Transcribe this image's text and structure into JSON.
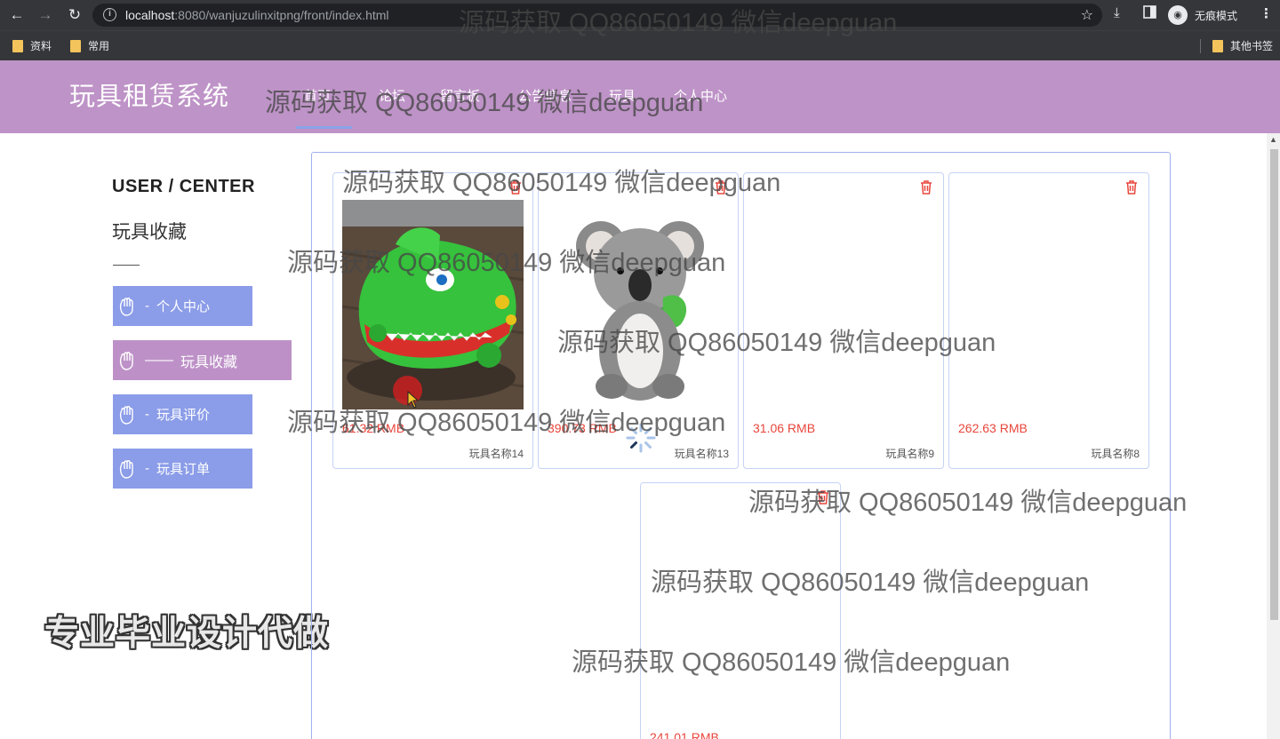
{
  "browser": {
    "url_host": "localhost",
    "url_path": ":8080/wanjuzulinxitpng/front/index.html",
    "incognito_label": "无痕模式",
    "bookmarks": [
      "资料",
      "常用"
    ],
    "other_bookmarks": "其他书签"
  },
  "header": {
    "site_title": "玩具租赁系统",
    "nav": [
      "首页",
      "论坛",
      "留言板",
      "公告信息",
      "玩具",
      "个人中心"
    ],
    "active_nav": "首页"
  },
  "sidebar": {
    "title": "USER / CENTER",
    "subtitle": "玩具收藏",
    "items": [
      {
        "label": "个人中心",
        "prefix": "-"
      },
      {
        "label": "玩具收藏",
        "prefix": "——"
      },
      {
        "label": "玩具评价",
        "prefix": "-"
      },
      {
        "label": "玩具订单",
        "prefix": "-"
      }
    ],
    "active_item": "玩具收藏"
  },
  "favorites": [
    {
      "price": "61.32 RMB",
      "name": "玩具名称14",
      "image": "crocodile-toy"
    },
    {
      "price": "390.73 RMB",
      "name": "玩具名称13",
      "image": "koala-plush"
    },
    {
      "price": "31.06 RMB",
      "name": "玩具名称9",
      "image": ""
    },
    {
      "price": "262.63 RMB",
      "name": "玩具名称8",
      "image": ""
    },
    {
      "price": "241.01 RMB",
      "name": "",
      "image": ""
    }
  ],
  "watermark": "源码获取 QQ86050149 微信deepguan",
  "promo": "专业毕业设计代做",
  "colors": {
    "header_bg": "#be93c7",
    "sidebar_btn": "#8b9ce8",
    "sidebar_btn_active": "#bd91c7",
    "price": "#e8463c",
    "card_border": "#c7d2f5"
  }
}
